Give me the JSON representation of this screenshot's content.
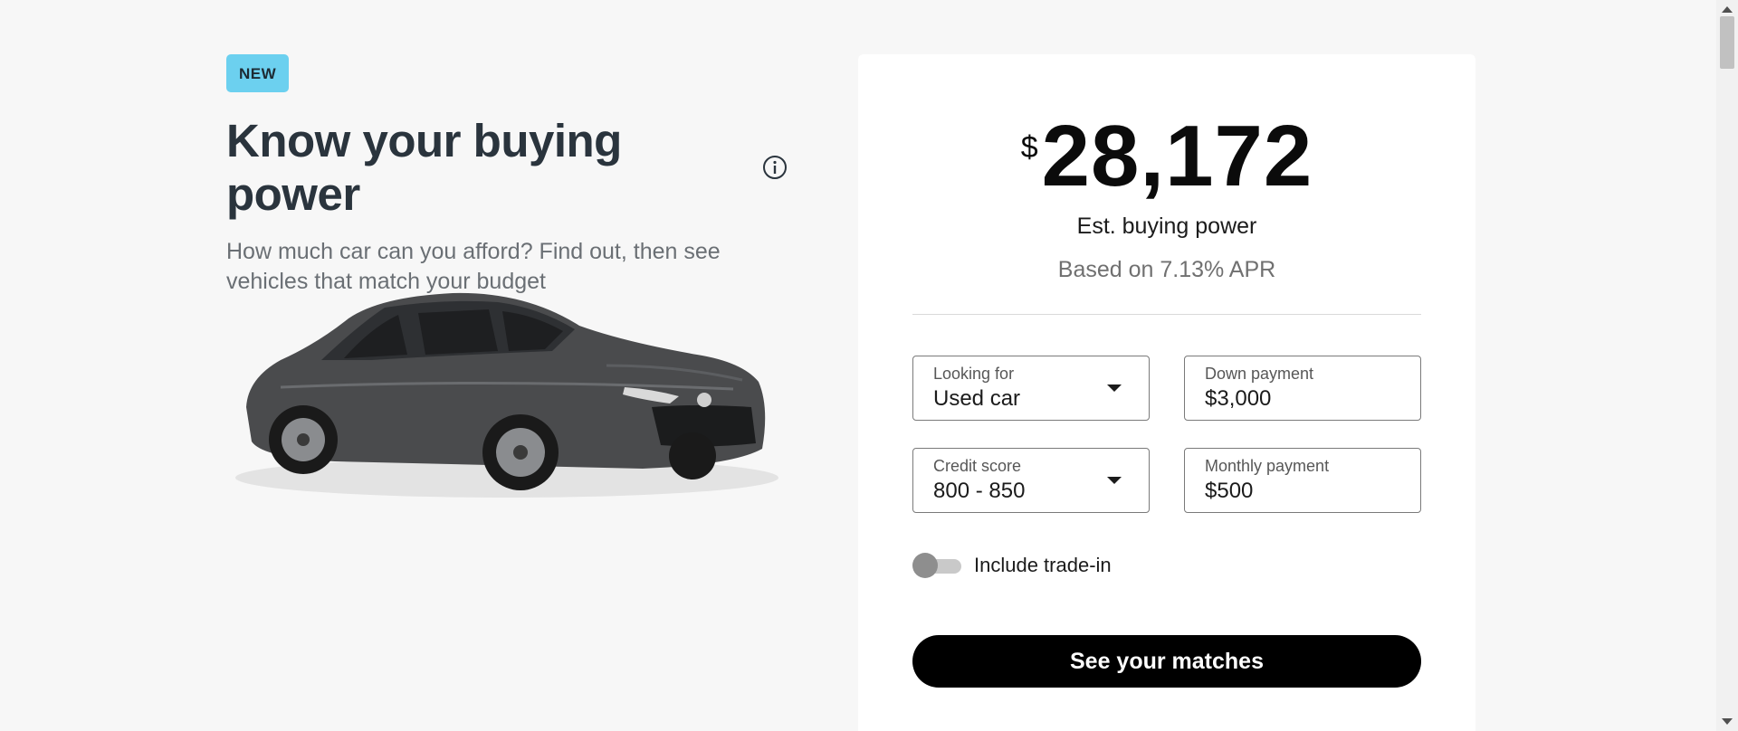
{
  "hero": {
    "badge": "NEW",
    "title": "Know your buying power",
    "subtitle": "How much car can you afford? Find out, then see vehicles that match your budget"
  },
  "calculator": {
    "currency_symbol": "$",
    "amount": "28,172",
    "amount_label": "Est. buying power",
    "apr_note": "Based on 7.13% APR",
    "fields": {
      "looking_for": {
        "label": "Looking for",
        "value": "Used car"
      },
      "down_payment": {
        "label": "Down payment",
        "value": "$3,000"
      },
      "credit_score": {
        "label": "Credit score",
        "value": "800 - 850"
      },
      "monthly_payment": {
        "label": "Monthly payment",
        "value": "$500"
      }
    },
    "trade_in": {
      "label": "Include trade-in",
      "enabled": false
    },
    "cta_label": "See your matches"
  },
  "colors": {
    "badge_bg": "#6cd0ef",
    "cta_bg": "#000000",
    "page_bg": "#f7f7f7",
    "car_body": "#4a4b4d"
  },
  "icons": [
    "info-icon",
    "chevron-down-icon",
    "car-image"
  ]
}
